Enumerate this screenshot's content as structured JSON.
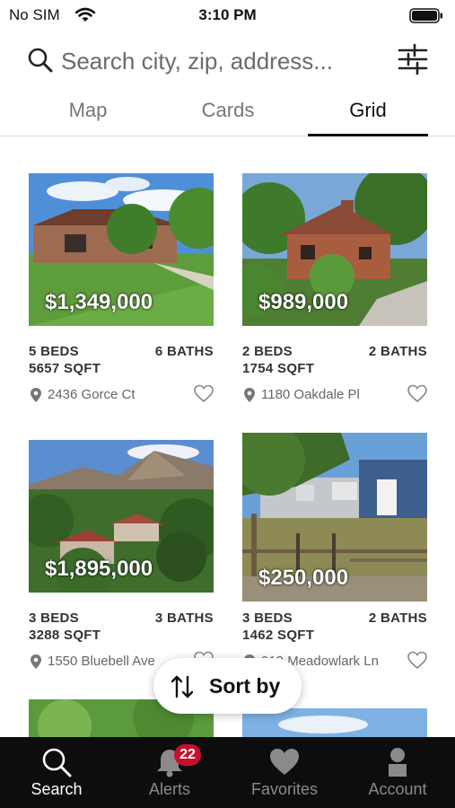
{
  "status_bar": {
    "carrier": "No SIM",
    "time": "3:10 PM"
  },
  "search": {
    "placeholder": "Search city, zip, address..."
  },
  "view_tabs": [
    {
      "label": "Map",
      "active": false
    },
    {
      "label": "Cards",
      "active": false
    },
    {
      "label": "Grid",
      "active": true
    }
  ],
  "listings": [
    {
      "price": "$1,349,000",
      "beds": "5 BEDS",
      "baths": "6 BATHS",
      "sqft": "5657 SQFT",
      "address": "2436 Gorce Ct"
    },
    {
      "price": "$989,000",
      "beds": "2 BEDS",
      "baths": "2 BATHS",
      "sqft": "1754 SQFT",
      "address": "1180 Oakdale Pl"
    },
    {
      "price": "$1,895,000",
      "beds": "3 BEDS",
      "baths": "3 BATHS",
      "sqft": "3288 SQFT",
      "address": "1550 Bluebell Ave"
    },
    {
      "price": "$250,000",
      "beds": "3 BEDS",
      "baths": "2 BATHS",
      "sqft": "1462 SQFT",
      "address": "918 Meadowlark Ln"
    }
  ],
  "sort_button": {
    "label": "Sort by"
  },
  "tab_bar": [
    {
      "label": "Search",
      "icon": "search-icon",
      "active": true
    },
    {
      "label": "Alerts",
      "icon": "bell-icon",
      "badge": "22"
    },
    {
      "label": "Favorites",
      "icon": "heart-icon"
    },
    {
      "label": "Account",
      "icon": "person-icon"
    }
  ],
  "colors": {
    "tab_bar_bg": "#0d0d0d",
    "badge": "#c8102e",
    "active_tab": "#111111"
  }
}
